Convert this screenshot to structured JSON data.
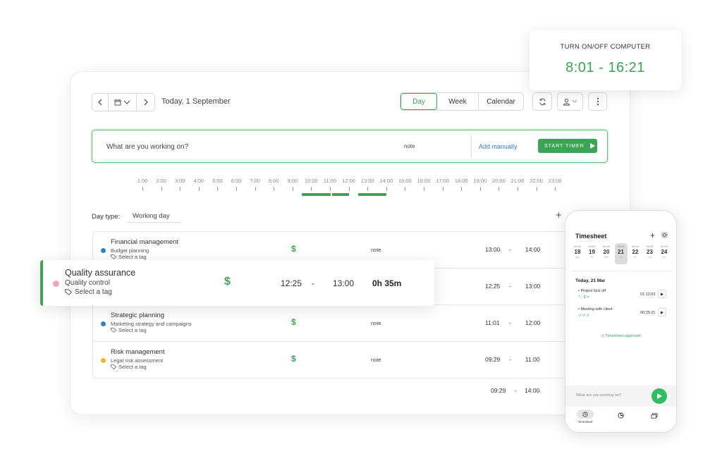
{
  "toolbar": {
    "date_label": "Today, 1 September",
    "views": [
      "Day",
      "Week",
      "Calendar"
    ],
    "active_view": "Day"
  },
  "timer": {
    "placeholder": "What are you working on?",
    "note": "note",
    "add_manually": "Add manually",
    "start_label": "START TIMER"
  },
  "timeline": {
    "hours": [
      "1:00",
      "2:00",
      "3:00",
      "4:00",
      "5:00",
      "6:00",
      "7:00",
      "8:00",
      "9:00",
      "10:00",
      "11:00",
      "12:00",
      "13:00",
      "14:00",
      "15:00",
      "16:00",
      "17:00",
      "18:00",
      "19:00",
      "20:00",
      "21:00",
      "22:00",
      "23:00"
    ],
    "segments": [
      {
        "start": 9.5,
        "end": 11.05
      },
      {
        "start": 11.1,
        "end": 12.0
      },
      {
        "start": 12.5,
        "end": 14.0
      }
    ]
  },
  "day_type": {
    "label": "Day type:",
    "value": "Working day",
    "add": "+"
  },
  "entries": [
    {
      "title": "Financial management",
      "sub": "Budget planning",
      "tag": "Select a tag",
      "dot": "#2e86c1",
      "dollar": "$",
      "note": "note",
      "start": "13:00",
      "dash": "-",
      "end": "14:00"
    },
    {
      "title": "",
      "sub": "",
      "tag": "",
      "dot": "",
      "dollar": "",
      "note": "",
      "start": "12:25",
      "dash": "-",
      "end": "13:00"
    },
    {
      "title": "Strategic planning",
      "sub": "Marketing strategy and campaigns",
      "tag": "Select a tag",
      "dot": "#2e86c1",
      "dollar": "$",
      "note": "note",
      "start": "11:01",
      "dash": "-",
      "end": "12:00"
    },
    {
      "title": "Risk management",
      "sub": "Legal risk assessment",
      "tag": "Select a tag",
      "dot": "#f0b429",
      "dollar": "$",
      "note": "note",
      "start": "09:29",
      "dash": "-",
      "end": "11:00"
    }
  ],
  "totals": {
    "start": "09:29",
    "dash": "-",
    "end": "14:00"
  },
  "qa_card": {
    "title": "Quality assurance",
    "sub": "Quality control",
    "tag": "Select a tag",
    "dollar": "$",
    "start": "12:25",
    "dash": "-",
    "end": "13:00",
    "duration": "0h 35m"
  },
  "onoff": {
    "label": "TURN ON/OFF COMPUTER",
    "time": "8:01 - 16:21"
  },
  "phone": {
    "title": "Timesheet",
    "plus": "+",
    "days": [
      {
        "t": "00:00",
        "n": "18",
        "w": "Mo"
      },
      {
        "t": "00:00",
        "n": "19",
        "w": "Tu"
      },
      {
        "t": "00:00",
        "n": "20",
        "w": "We"
      },
      {
        "t": "00:00",
        "n": "21",
        "w": "Th",
        "selected": true
      },
      {
        "t": "00:00",
        "n": "22",
        "w": "Fr"
      },
      {
        "t": "00:00",
        "n": "23",
        "w": "Sa"
      },
      {
        "t": "00:00",
        "n": "24",
        "w": "Su"
      }
    ],
    "date": "Today, 21 Mar",
    "entries": [
      {
        "name": "• Project kick off",
        "icons": "🏷 $ ✎",
        "duration": "01:12:03"
      },
      {
        "name": "• Meeting with client",
        "icons": "↺ ↺ ↺",
        "duration": "00:35:21"
      }
    ],
    "approved": "Timesheet approved",
    "input_placeholder": "What are you working on?",
    "nav": [
      "Timesheet",
      "",
      ""
    ]
  },
  "colors": {
    "accent": "#3aa655",
    "link": "#2d7be0",
    "qa_dot": "#f0a7b8"
  }
}
